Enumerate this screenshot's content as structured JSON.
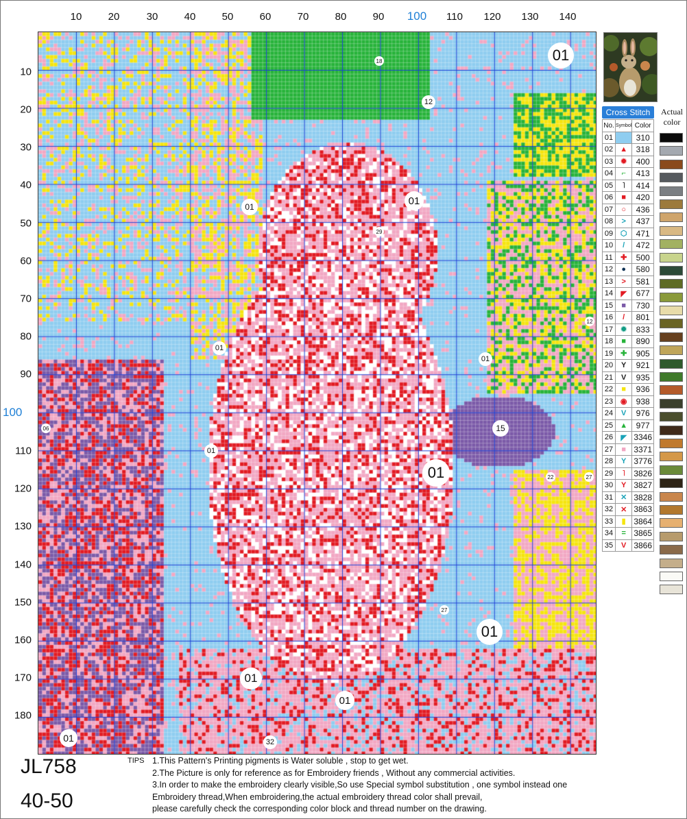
{
  "axis": {
    "x_labels": [
      "10",
      "20",
      "30",
      "40",
      "50",
      "60",
      "70",
      "80",
      "90",
      "100",
      "110",
      "120",
      "130",
      "140"
    ],
    "y_labels": [
      "10",
      "20",
      "30",
      "40",
      "50",
      "60",
      "70",
      "80",
      "90",
      "100",
      "110",
      "120",
      "130",
      "140",
      "150",
      "160",
      "170",
      "180"
    ],
    "highlight": "100"
  },
  "region_labels": [
    {
      "text": "01",
      "size": "large"
    },
    {
      "text": "18",
      "size": "tiny"
    },
    {
      "text": "12",
      "size": "small"
    },
    {
      "text": "01",
      "size": "medium"
    },
    {
      "text": "01",
      "size": "medium"
    },
    {
      "text": "29",
      "size": "tiny"
    },
    {
      "text": "12",
      "size": "tiny"
    },
    {
      "text": "01",
      "size": "small"
    },
    {
      "text": "01",
      "size": "small"
    },
    {
      "text": "06",
      "size": "tiny"
    },
    {
      "text": "01",
      "size": "small"
    },
    {
      "text": "15",
      "size": "medium"
    },
    {
      "text": "01",
      "size": "large"
    },
    {
      "text": "22",
      "size": "tiny"
    },
    {
      "text": "27",
      "size": "tiny"
    },
    {
      "text": "27",
      "size": "tiny"
    },
    {
      "text": "01",
      "size": "large"
    },
    {
      "text": "01",
      "size": "medium"
    },
    {
      "text": "01",
      "size": "medium"
    },
    {
      "text": "32",
      "size": "small"
    },
    {
      "text": "01",
      "size": "medium"
    }
  ],
  "legend": {
    "title": "Cross Stitch",
    "col_no": "No.",
    "col_symbol": "Symbol",
    "col_color": "Color",
    "actual_label": "Actual color",
    "rows": [
      {
        "no": "01",
        "symbol": "■",
        "color": "310",
        "display": "#8fcdf0",
        "actual": "#0a0a0a"
      },
      {
        "no": "02",
        "symbol": "▲",
        "color": "318",
        "display": "#e21b23",
        "actual": "#a4a9b0"
      },
      {
        "no": "03",
        "symbol": "✹",
        "color": "400",
        "display": "#e21b23",
        "actual": "#8a4a1c"
      },
      {
        "no": "04",
        "symbol": "⌐",
        "color": "413",
        "display": "#27b33a",
        "actual": "#565a5e"
      },
      {
        "no": "05",
        "symbol": "˥",
        "color": "414",
        "display": "#222222",
        "actual": "#7b7f83"
      },
      {
        "no": "06",
        "symbol": "■",
        "color": "420",
        "display": "#e21b23",
        "actual": "#9c7a3c"
      },
      {
        "no": "07",
        "symbol": "○",
        "color": "436",
        "display": "#e21b23",
        "actual": "#cfa56c"
      },
      {
        "no": "08",
        "symbol": ">",
        "color": "437",
        "display": "#1aa3b8",
        "actual": "#d9b984"
      },
      {
        "no": "09",
        "symbol": "⬡",
        "color": "471",
        "display": "#1aa3b8",
        "actual": "#a2b161"
      },
      {
        "no": "10",
        "symbol": "/",
        "color": "472",
        "display": "#1aa3b8",
        "actual": "#c8d48c"
      },
      {
        "no": "11",
        "symbol": "✚",
        "color": "500",
        "display": "#e21b23",
        "actual": "#2c4a38"
      },
      {
        "no": "12",
        "symbol": "●",
        "color": "580",
        "display": "#113355",
        "actual": "#5e6b24"
      },
      {
        "no": "13",
        "symbol": ">",
        "color": "581",
        "display": "#e21b23",
        "actual": "#8a9a3a"
      },
      {
        "no": "14",
        "symbol": "◤",
        "color": "677",
        "display": "#e21b23",
        "actual": "#e8dcaa"
      },
      {
        "no": "15",
        "symbol": "■",
        "color": "730",
        "display": "#7b5aa8",
        "actual": "#6a6424"
      },
      {
        "no": "16",
        "symbol": "/",
        "color": "801",
        "display": "#e21b23",
        "actual": "#66401e"
      },
      {
        "no": "17",
        "symbol": "✹",
        "color": "833",
        "display": "#129c84",
        "actual": "#bfa55a"
      },
      {
        "no": "18",
        "symbol": "■",
        "color": "890",
        "display": "#27b33a",
        "actual": "#2f5a2c"
      },
      {
        "no": "19",
        "symbol": "✚",
        "color": "905",
        "display": "#27b33a",
        "actual": "#3f7a2a"
      },
      {
        "no": "20",
        "symbol": "Y",
        "color": "921",
        "display": "#222222",
        "actual": "#b45a2a"
      },
      {
        "no": "21",
        "symbol": "V",
        "color": "935",
        "display": "#222222",
        "actual": "#3a3f2c"
      },
      {
        "no": "22",
        "symbol": "■",
        "color": "936",
        "display": "#f5e50f",
        "actual": "#4a4e2c"
      },
      {
        "no": "23",
        "symbol": "◉",
        "color": "938",
        "display": "#e21b23",
        "actual": "#3f2a1a"
      },
      {
        "no": "24",
        "symbol": "V",
        "color": "976",
        "display": "#1aa3b8",
        "actual": "#c07a2e"
      },
      {
        "no": "25",
        "symbol": "▲",
        "color": "977",
        "display": "#27b33a",
        "actual": "#d49848"
      },
      {
        "no": "26",
        "symbol": "◤",
        "color": "3346",
        "display": "#1aa3b8",
        "actual": "#6a8a3a"
      },
      {
        "no": "27",
        "symbol": "■",
        "color": "3371",
        "display": "#f2a7c3",
        "actual": "#2e2416"
      },
      {
        "no": "28",
        "symbol": "Y",
        "color": "3776",
        "display": "#1aa3b8",
        "actual": "#c9864c"
      },
      {
        "no": "29",
        "symbol": "˥",
        "color": "3826",
        "display": "#e21b23",
        "actual": "#b2782e"
      },
      {
        "no": "30",
        "symbol": "Y",
        "color": "3827",
        "display": "#e21b23",
        "actual": "#e6b070"
      },
      {
        "no": "31",
        "symbol": "✕",
        "color": "3828",
        "display": "#1aa3b8",
        "actual": "#b79b6c"
      },
      {
        "no": "32",
        "symbol": "✕",
        "color": "3863",
        "display": "#e21b23",
        "actual": "#8a6a4a"
      },
      {
        "no": "33",
        "symbol": "▮",
        "color": "3864",
        "display": "#f5e50f",
        "actual": "#c4ae8a"
      },
      {
        "no": "34",
        "symbol": "=",
        "color": "3865",
        "display": "#27b33a",
        "actual": "#fafaf6"
      },
      {
        "no": "35",
        "symbol": "V",
        "color": "3866",
        "display": "#e21b23",
        "actual": "#e8e4d8"
      }
    ]
  },
  "footer": {
    "code": "JL758",
    "size": "40-50",
    "tips_label": "TIPS",
    "tips": [
      "1.This Pattern's Printing pigments is Water soluble , stop to get wet.",
      "2.The Picture is only for reference as for Embroidery friends , Without any commercial activities.",
      "3.In order to make the embroidery clearly visible,So use Special symbol substitution , one symbol instead one",
      "Embroidery thread,When embroidering,the actual embroidery thread color shall prevail,",
      "please carefully check the corresponding color block and thread number on the drawing."
    ]
  },
  "thumbnail": {
    "icon": "rabbit-picture"
  },
  "palette": {
    "background": "#8fcdf0",
    "pink": "#f2a7c3",
    "red": "#e21b23",
    "green": "#27b33a",
    "yellow": "#f5e50f",
    "purple": "#7b5aa8",
    "teal": "#1aa3b8",
    "grid_minor": "#ffffff",
    "grid_major": "#1a3fd6",
    "axis_highlight": "#1e7fd6"
  }
}
